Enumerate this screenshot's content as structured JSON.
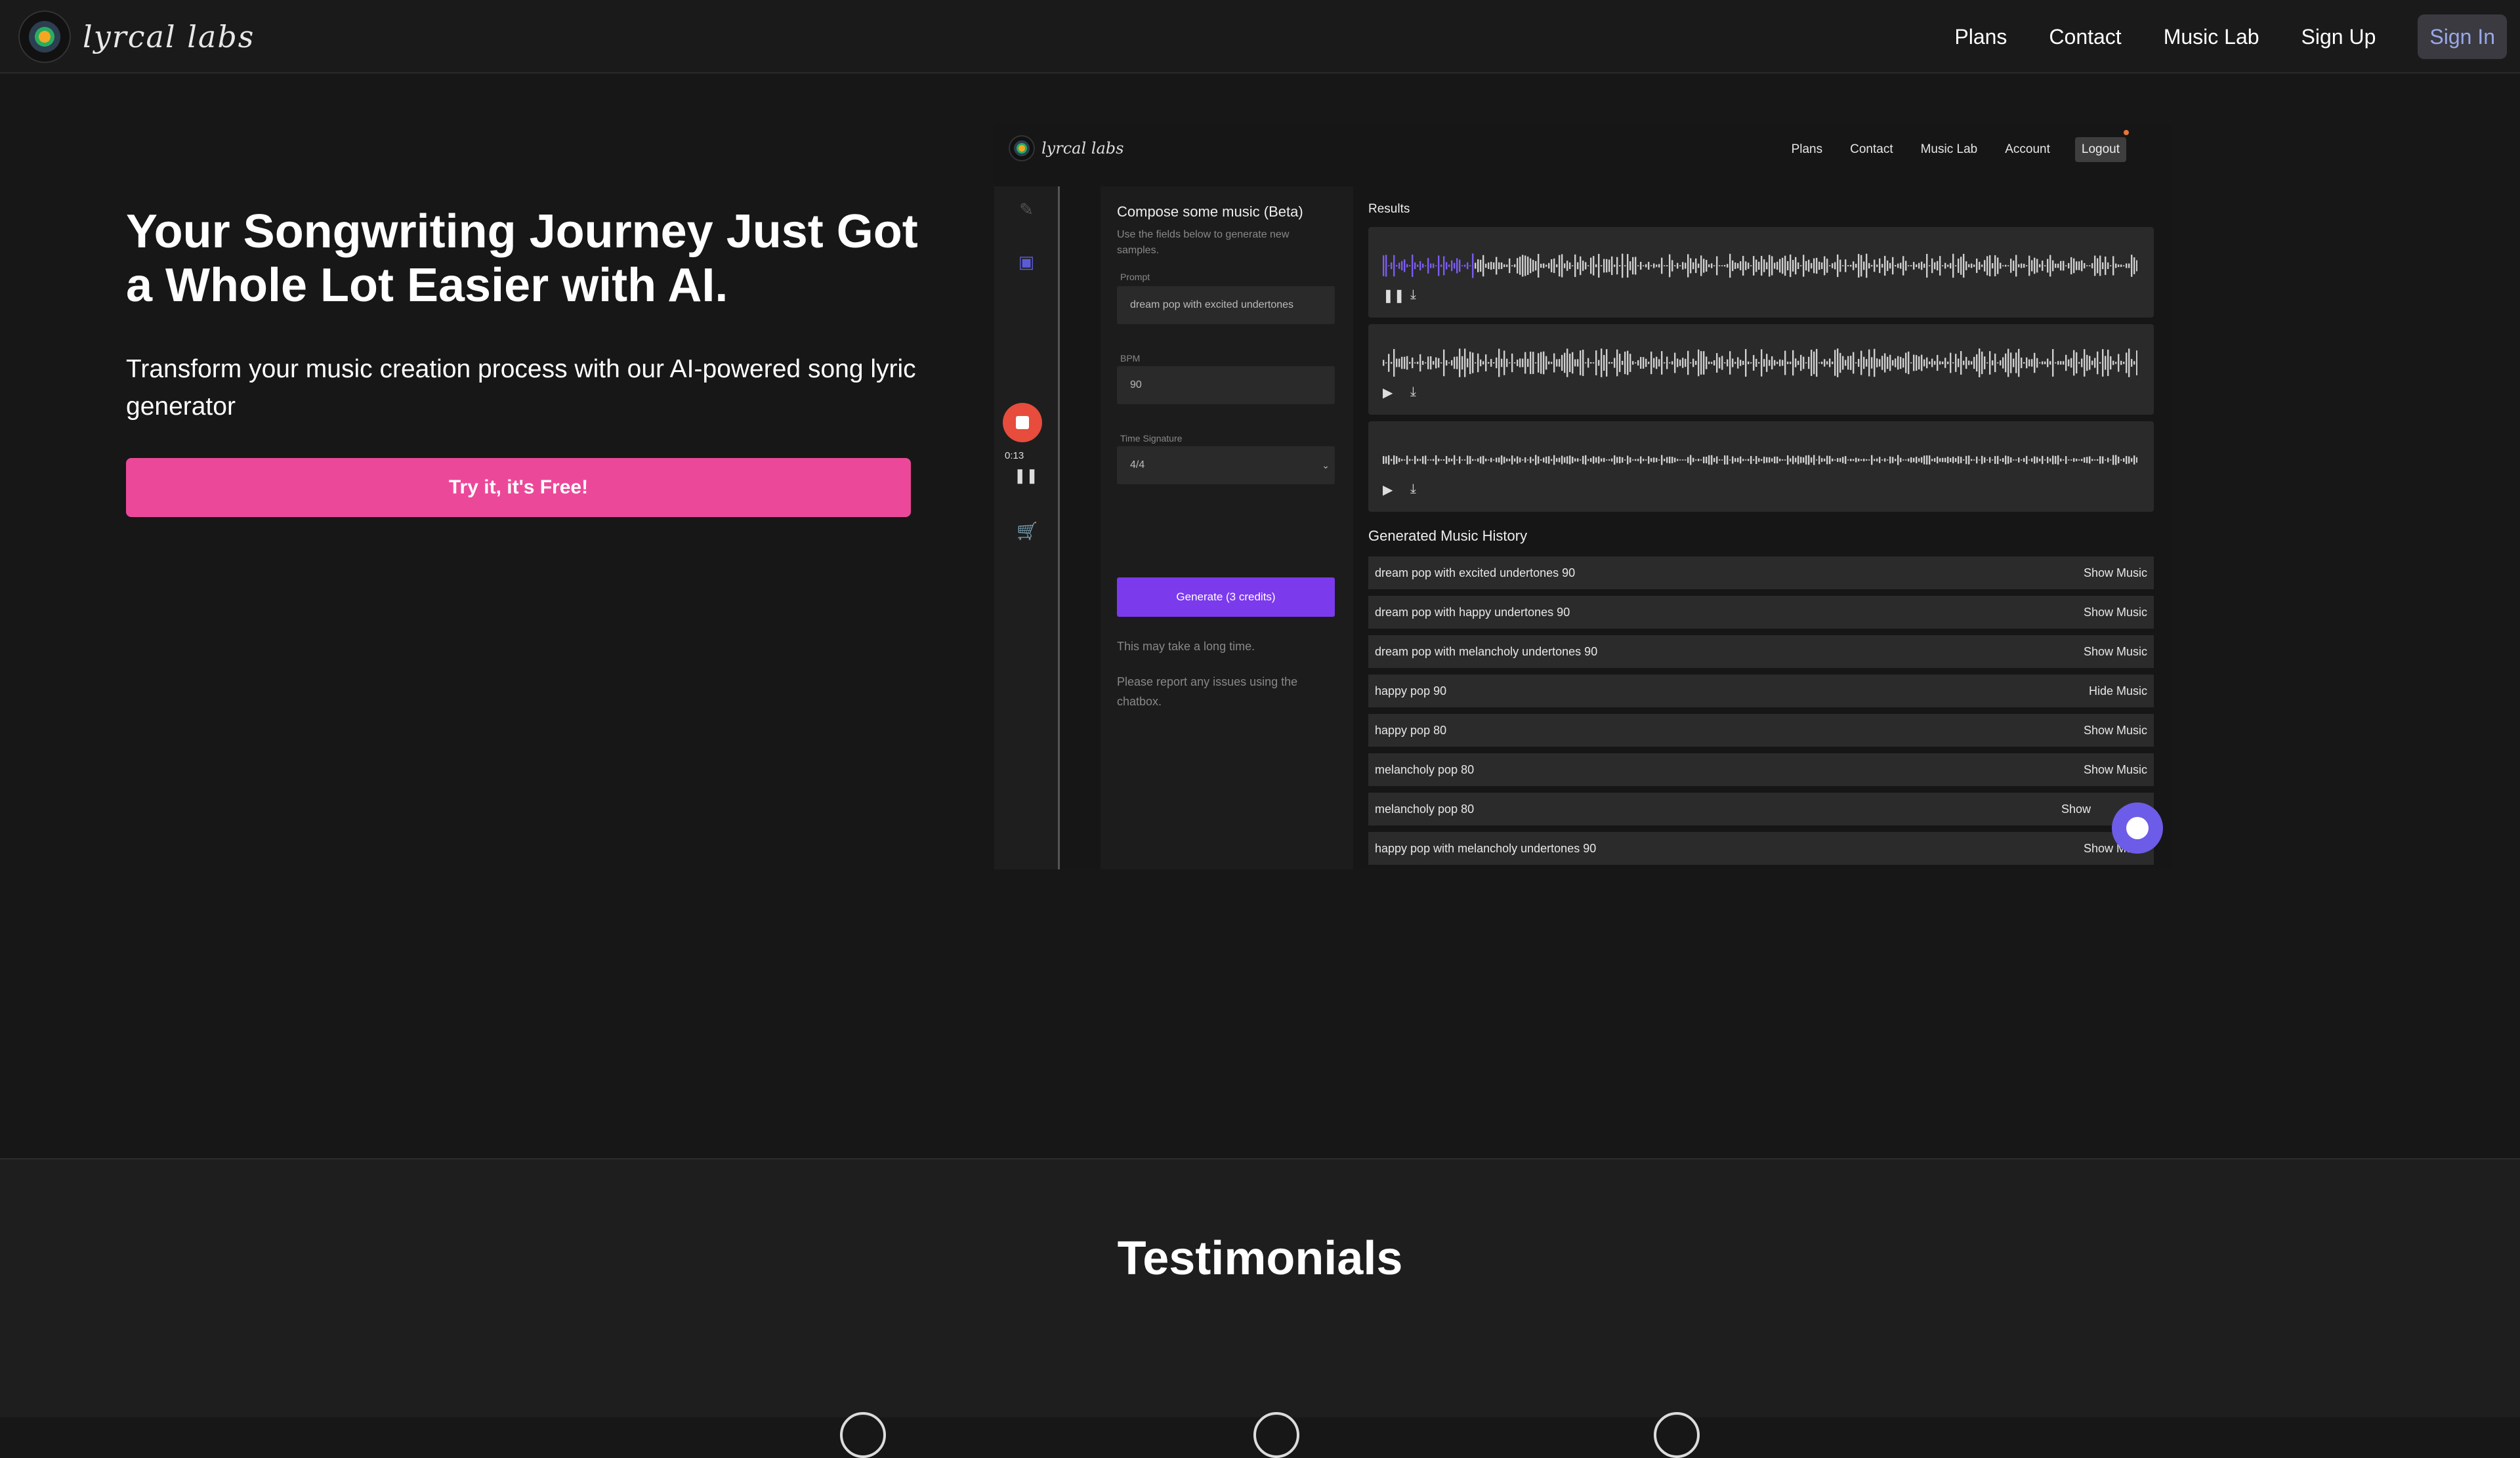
{
  "nav": {
    "logo_text": "lyrcal labs",
    "links": [
      "Plans",
      "Contact",
      "Music Lab",
      "Sign Up"
    ],
    "sign_in": "Sign In"
  },
  "hero": {
    "title": "Your Songwriting Journey Just Got a Whole Lot Easier with AI.",
    "subtitle": "Transform your music creation process with our AI-powered song lyric generator",
    "cta": "Try it, it's Free!"
  },
  "preview": {
    "logo_text": "lyrcal labs",
    "nav": [
      "Plans",
      "Contact",
      "Music Lab",
      "Account"
    ],
    "logout": "Logout",
    "recorder": {
      "time": "0:13"
    },
    "form": {
      "title": "Compose some music (Beta)",
      "description": "Use the fields below to generate new samples.",
      "prompt_label": "Prompt",
      "prompt_value": "dream pop with excited undertones",
      "bpm_label": "BPM",
      "bpm_value": "90",
      "time_sig_label": "Time Signature",
      "time_sig_value": "4/4",
      "generate": "Generate (3 credits)",
      "note1": "This may take a long time.",
      "note2": "Please report any issues using the chatbox."
    },
    "results_title": "Results",
    "history_title": "Generated Music History",
    "history": [
      {
        "name": "dream pop with excited undertones 90",
        "action": "Show Music"
      },
      {
        "name": "dream pop with happy undertones 90",
        "action": "Show Music"
      },
      {
        "name": "dream pop with melancholy undertones 90",
        "action": "Show Music"
      },
      {
        "name": "happy pop 90",
        "action": "Hide Music"
      },
      {
        "name": "happy pop 80",
        "action": "Show Music"
      },
      {
        "name": "melancholy pop 80",
        "action": "Show Music"
      },
      {
        "name": "melancholy pop 80",
        "action": "Show"
      },
      {
        "name": "happy pop with melancholy undertones 90",
        "action": "Show Music"
      }
    ]
  },
  "testimonials": {
    "title": "Testimonials"
  },
  "colors": {
    "accent_pink": "#ec4899",
    "accent_purple": "#7c3aed",
    "signin_text": "#9aa8e8"
  }
}
